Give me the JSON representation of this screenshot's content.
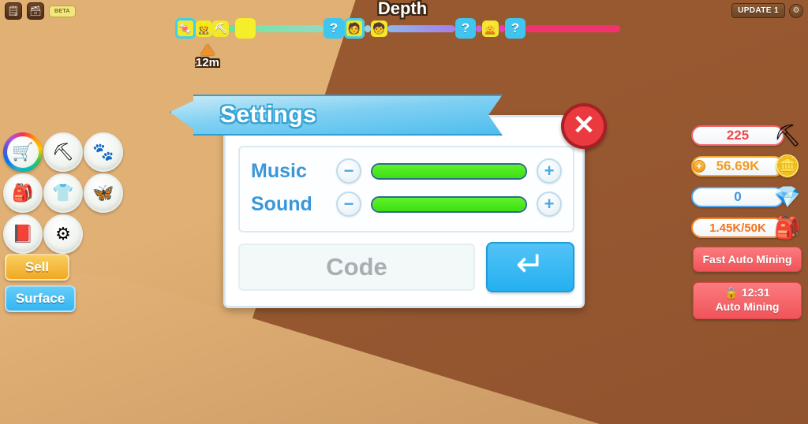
{
  "topbar": {
    "icons": [
      {
        "name": "notes-icon",
        "glyph": "🗒"
      },
      {
        "name": "chest-icon",
        "glyph": "🗃"
      }
    ],
    "beta_badge": "BETA",
    "update_label": "UPDATE 1",
    "settings_dot_glyph": "⚙"
  },
  "depth": {
    "title": "Depth",
    "marker_value": "12m",
    "nodes": [
      {
        "name": "depth-node-candy",
        "type": "char",
        "glyph": "🍬",
        "highlighted": true
      },
      {
        "name": "depth-node-miner",
        "type": "char",
        "glyph": "👷",
        "highlighted": false
      },
      {
        "name": "depth-node-pick",
        "type": "char",
        "glyph": "⛏",
        "highlighted": false
      },
      {
        "name": "depth-node-blank",
        "type": "yellow",
        "glyph": "",
        "highlighted": false
      },
      {
        "name": "depth-node-unknown-1",
        "type": "question",
        "glyph": "?",
        "highlighted": false
      },
      {
        "name": "depth-node-char-1",
        "type": "char",
        "glyph": "🧑",
        "highlighted": true
      },
      {
        "name": "depth-node-char-2",
        "type": "char",
        "glyph": "🧒",
        "highlighted": false
      },
      {
        "name": "depth-node-unknown-2",
        "type": "question",
        "glyph": "?",
        "highlighted": false
      },
      {
        "name": "depth-node-char-3",
        "type": "char",
        "glyph": "👱",
        "highlighted": false
      },
      {
        "name": "depth-node-unknown-3",
        "type": "question",
        "glyph": "?",
        "highlighted": false
      }
    ],
    "segment_colors": [
      "#63e39b",
      "#7ae3a8",
      "#8fdcc4",
      "#9ad0e0",
      "#8fb6ee",
      "#a57fe8",
      "#c45fe0",
      "#e83fb0",
      "#f2336f"
    ]
  },
  "sidebar": {
    "icons": [
      {
        "name": "shop-icon",
        "glyph": "🛒",
        "rainbow": true
      },
      {
        "name": "pickaxe-icon",
        "glyph": "⛏",
        "rainbow": false
      },
      {
        "name": "pets-paw-icon",
        "glyph": "🐾",
        "rainbow": false
      },
      {
        "name": "backpack-icon",
        "glyph": "🎒",
        "rainbow": false
      },
      {
        "name": "shirt-icon",
        "glyph": "👕",
        "rainbow": false
      },
      {
        "name": "wings-icon",
        "glyph": "🦋",
        "rainbow": false
      },
      {
        "name": "index-book-icon",
        "glyph": "📕",
        "rainbow": false
      },
      {
        "name": "settings-gear-icon",
        "glyph": "⚙",
        "rainbow": false
      }
    ],
    "sell_label": "Sell",
    "surface_label": "Surface"
  },
  "hud": {
    "stats": [
      {
        "name": "strength-stat",
        "value": "225",
        "icon": "⛏",
        "style": "red",
        "has_plus": false
      },
      {
        "name": "coins-stat",
        "value": "56.69K",
        "icon": "🪙",
        "style": "gold",
        "has_plus": true,
        "plus": "+"
      },
      {
        "name": "gems-stat",
        "value": "0",
        "icon": "💎",
        "style": "blue",
        "has_plus": false
      },
      {
        "name": "capacity-stat",
        "value": "1.45K/50K",
        "icon": "🎒",
        "style": "orange",
        "has_plus": false
      }
    ],
    "fast_auto_mining_label": "Fast Auto Mining",
    "auto_mining_timer": "12:31",
    "auto_mining_lock_icon": "🔒",
    "auto_mining_label": "Auto Mining"
  },
  "settings": {
    "title": "Settings",
    "close_glyph": "✕",
    "audio": [
      {
        "name": "music-row",
        "label": "Music",
        "minus": "−",
        "plus": "+",
        "value": 100
      },
      {
        "name": "sound-row",
        "label": "Sound",
        "minus": "−",
        "plus": "+",
        "value": 100
      }
    ],
    "code_placeholder": "Code",
    "submit_glyph": "↵"
  },
  "colors": {
    "sand": "#e0b074",
    "dirt": "#97572f",
    "accent_blue": "#4fbdee",
    "slider_green": "#3ede14",
    "close_red": "#eb3a3f"
  }
}
